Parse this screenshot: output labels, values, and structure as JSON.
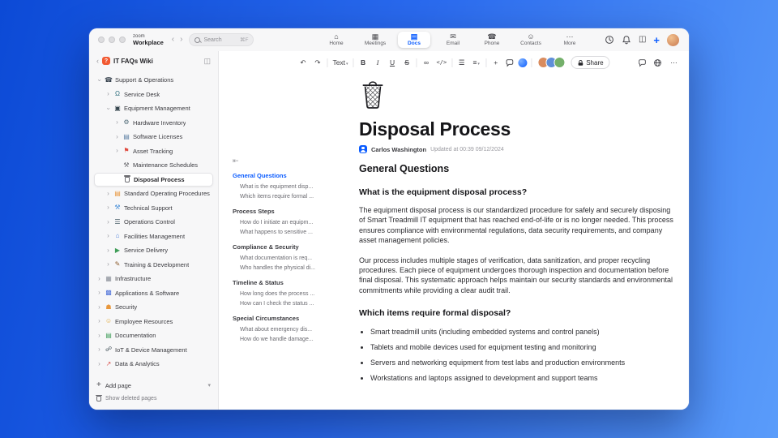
{
  "accent": "#0b5cff",
  "background": {
    "gradient_start": "#0c4ad6",
    "gradient_end": "#5a9cfa"
  },
  "titlebar": {
    "logo_top": "zoom",
    "logo_bottom": "Workplace",
    "back_chevron": "‹",
    "forward_chevron": "›",
    "search": {
      "placeholder": "Search",
      "shortcut": "⌘F"
    },
    "tabs": [
      {
        "label": "Home",
        "icon": "home-icon",
        "glyph": "⌂",
        "active": false
      },
      {
        "label": "Meetings",
        "icon": "calendar-icon",
        "glyph": "▦",
        "active": false
      },
      {
        "label": "Docs",
        "icon": "doc-icon",
        "glyph": "▤",
        "active": true
      },
      {
        "label": "Email",
        "icon": "mail-icon",
        "glyph": "✉",
        "active": false
      },
      {
        "label": "Phone",
        "icon": "phone-icon",
        "glyph": "☎",
        "active": false
      },
      {
        "label": "Contacts",
        "icon": "contacts-icon",
        "glyph": "☺",
        "active": false
      },
      {
        "label": "More",
        "icon": "more-icon",
        "glyph": "⋯",
        "active": false
      }
    ]
  },
  "sidebar": {
    "title": "IT FAQs Wiki",
    "tree": [
      {
        "label": "Support & Operations",
        "depth": 0,
        "icon": "phone-icon",
        "glyph": "☎",
        "color": "#37424e",
        "chevron": "down",
        "selected": false
      },
      {
        "label": "Service Desk",
        "depth": 1,
        "icon": "headset-icon",
        "glyph": "Ω",
        "color": "#2f6f7e",
        "chevron": "right",
        "selected": false
      },
      {
        "label": "Equipment Management",
        "depth": 1,
        "icon": "monitor-icon",
        "glyph": "▣",
        "color": "#37474f",
        "chevron": "down",
        "selected": false
      },
      {
        "label": "Hardware Inventory",
        "depth": 2,
        "icon": "joystick-icon",
        "glyph": "⚙",
        "color": "#546e7a",
        "chevron": "right",
        "selected": false
      },
      {
        "label": "Software Licenses",
        "depth": 2,
        "icon": "license-icon",
        "glyph": "▤",
        "color": "#5c7fa3",
        "chevron": "right",
        "selected": false
      },
      {
        "label": "Asset Tracking",
        "depth": 2,
        "icon": "pin-icon",
        "glyph": "⚑",
        "color": "#e04a3f",
        "chevron": "right",
        "selected": false
      },
      {
        "label": "Maintenance Schedules",
        "depth": 2,
        "icon": "tools-icon",
        "glyph": "⚒",
        "color": "#6d6d72",
        "chevron": "none",
        "selected": false
      },
      {
        "label": "Disposal Process",
        "depth": 2,
        "icon": "trash-icon",
        "glyph": "trash",
        "color": "#6d6d72",
        "chevron": "none",
        "selected": true
      },
      {
        "label": "Standard Operating Procedures",
        "depth": 1,
        "icon": "book-icon",
        "glyph": "▤",
        "color": "#e8973d",
        "chevron": "right",
        "selected": false
      },
      {
        "label": "Technical Support",
        "depth": 1,
        "icon": "wrench-icon",
        "glyph": "⚒",
        "color": "#4a90d9",
        "chevron": "right",
        "selected": false
      },
      {
        "label": "Operations Control",
        "depth": 1,
        "icon": "sliders-icon",
        "glyph": "☰",
        "color": "#455a64",
        "chevron": "right",
        "selected": false
      },
      {
        "label": "Facilities Management",
        "depth": 1,
        "icon": "building-icon",
        "glyph": "⌂",
        "color": "#4a7fd9",
        "chevron": "right",
        "selected": false
      },
      {
        "label": "Service Delivery",
        "depth": 1,
        "icon": "delivery-icon",
        "glyph": "▶",
        "color": "#3f9d58",
        "chevron": "right",
        "selected": false
      },
      {
        "label": "Training & Development",
        "depth": 1,
        "icon": "training-icon",
        "glyph": "✎",
        "color": "#8a5a2b",
        "chevron": "right",
        "selected": false
      },
      {
        "label": "Infrastructure",
        "depth": 0,
        "icon": "server-icon",
        "glyph": "▦",
        "color": "#8a8f98",
        "chevron": "right",
        "selected": false
      },
      {
        "label": "Applications & Software",
        "depth": 0,
        "icon": "apps-icon",
        "glyph": "▩",
        "color": "#4a6fd9",
        "chevron": "right",
        "selected": false
      },
      {
        "label": "Security",
        "depth": 0,
        "icon": "shield-icon",
        "glyph": "☗",
        "color": "#e8973d",
        "chevron": "right",
        "selected": false
      },
      {
        "label": "Employee Resources",
        "depth": 0,
        "icon": "people-icon",
        "glyph": "☺",
        "color": "#e0a93e",
        "chevron": "right",
        "selected": false
      },
      {
        "label": "Documentation",
        "depth": 0,
        "icon": "books-icon",
        "glyph": "▤",
        "color": "#3f9d58",
        "chevron": "right",
        "selected": false
      },
      {
        "label": "IoT & Device Management",
        "depth": 0,
        "icon": "device-icon",
        "glyph": "☍",
        "color": "#37474f",
        "chevron": "right",
        "selected": false
      },
      {
        "label": "Data & Analytics",
        "depth": 0,
        "icon": "chart-icon",
        "glyph": "↗",
        "color": "#d9534f",
        "chevron": "right",
        "selected": false
      }
    ],
    "add_page": "Add page",
    "show_deleted": "Show deleted pages"
  },
  "toc": {
    "sections": [
      {
        "title": "General Questions",
        "active": true,
        "items": [
          "What is the equipment disp...",
          "Which items require formal ..."
        ]
      },
      {
        "title": "Process Steps",
        "active": false,
        "items": [
          "How do I initiate an equipm...",
          "What happens to sensitive ..."
        ]
      },
      {
        "title": "Compliance & Security",
        "active": false,
        "items": [
          "What documentation is req...",
          "Who handles the physical di..."
        ]
      },
      {
        "title": "Timeline & Status",
        "active": false,
        "items": [
          "How long does the process ...",
          "How can I check the status ..."
        ]
      },
      {
        "title": "Special Circumstances",
        "active": false,
        "items": [
          "What about emergency dis...",
          "How do we handle damage..."
        ]
      }
    ]
  },
  "doc": {
    "toolbar": {
      "text_style": "Text",
      "bold": "B",
      "italic": "I",
      "underline": "U",
      "strike": "S",
      "code": "</>",
      "share": "Share"
    },
    "title": "Disposal Process",
    "author": "Carlos Washington",
    "updated": "Updated at 00:39 09/12/2024",
    "blocks": [
      {
        "type": "h2",
        "text": "General Questions"
      },
      {
        "type": "h3",
        "text": "What is the equipment disposal process?"
      },
      {
        "type": "p",
        "text": "The equipment disposal process is our standardized procedure for safely and securely disposing of Smart Treadmill IT equipment that has reached end-of-life or is no longer needed. This process ensures compliance with environmental regulations, data security requirements, and company asset management policies."
      },
      {
        "type": "p",
        "text": "Our process includes multiple stages of verification, data sanitization, and proper recycling procedures. Each piece of equipment undergoes thorough inspection and documentation before final disposal. This systematic approach helps maintain our security standards and environmental commitments while providing a clear audit trail."
      },
      {
        "type": "h3",
        "text": "Which items require formal disposal?"
      },
      {
        "type": "ul",
        "items": [
          "Smart treadmill units (including embedded systems and control panels)",
          "Tablets and mobile devices used for equipment testing and monitoring",
          "Servers and networking equipment from test labs and production environments",
          "Workstations and laptops assigned to development and support teams"
        ]
      }
    ]
  }
}
